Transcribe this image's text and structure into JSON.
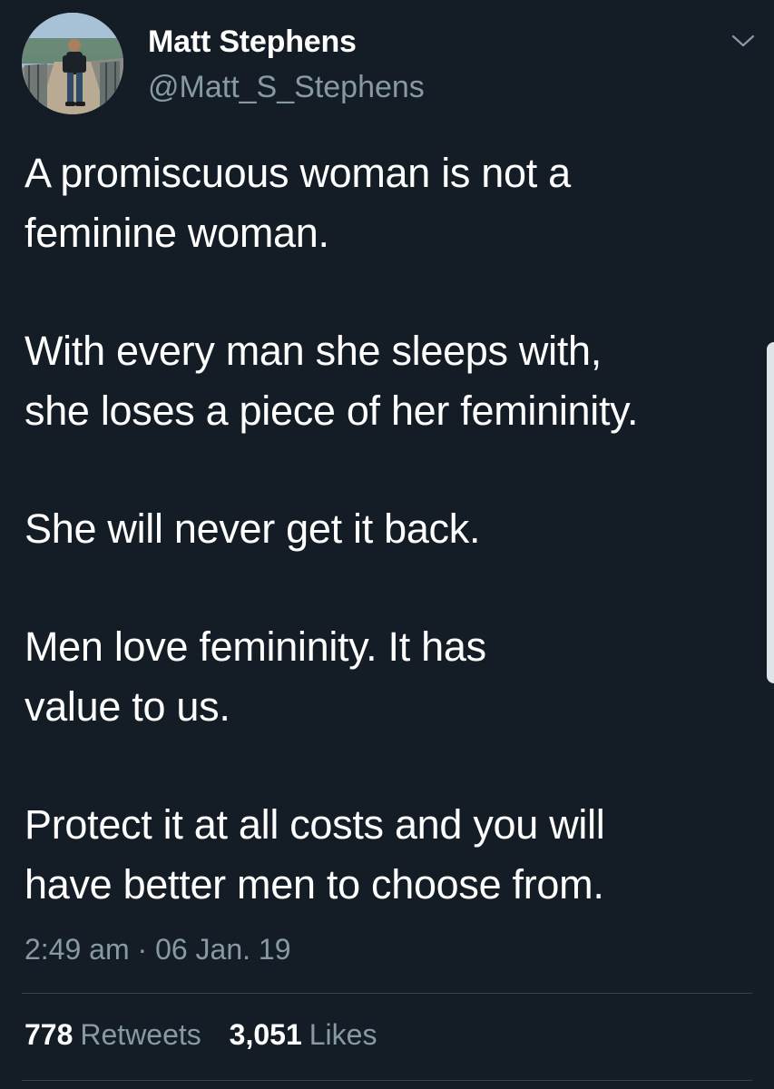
{
  "author": {
    "name": "Matt Stephens",
    "handle": "@Matt_S_Stephens",
    "avatar_icon": "profile-photo-man-walking"
  },
  "tweet": {
    "paragraphs": [
      {
        "lines": [
          "A promiscuous woman is not a",
          "feminine woman."
        ]
      },
      {
        "lines": [
          "With every man she sleeps with,",
          "she loses a piece of her femininity."
        ]
      },
      {
        "lines": [
          "She will never get it back."
        ]
      },
      {
        "lines": [
          "Men love femininity. It has",
          "value to us."
        ]
      },
      {
        "lines": [
          "Protect it at all costs and you will",
          "have better men to choose from."
        ]
      }
    ],
    "timestamp": "2:49 am · 06 Jan. 19"
  },
  "stats": {
    "retweets_count": "778",
    "retweets_label": "Retweets",
    "likes_count": "3,051",
    "likes_label": "Likes"
  },
  "colors": {
    "background": "#141d26",
    "text": "#ffffff",
    "secondary_text": "#8899a6",
    "divider": "#38444d"
  },
  "icons": {
    "menu": "chevron-down-icon"
  }
}
